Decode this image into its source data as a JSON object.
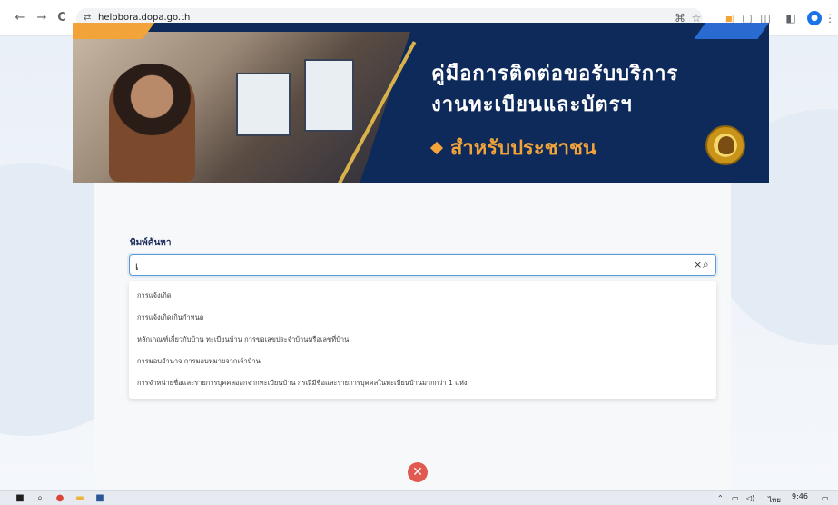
{
  "browser": {
    "back": "←",
    "forward": "→",
    "reload": "C",
    "site_icon": "⇄",
    "url": "helpbora.dopa.go.th",
    "tools": [
      "translate-icon",
      "star-icon",
      "extension-icon",
      "screenshot-icon",
      "puzzle-icon",
      "sidepanel-icon"
    ],
    "profile_initial": "●",
    "menu": "⋮"
  },
  "banner": {
    "line1": "คู่มือการติดต่อขอรับบริการ",
    "line2": "งานทะเบียนและบัตรฯ",
    "line3": "สำหรับประชาชน"
  },
  "search": {
    "label": "พิมพ์ค้นหา",
    "value": "เ",
    "clear": "×",
    "icon": "🔍"
  },
  "suggestions": [
    "การแจ้งเกิด",
    "การแจ้งเกิดเกินกำหนด",
    "หลักเกณฑ์เกี่ยวกับบ้าน ทะเบียนบ้าน การขอเลขประจำบ้านหรือเลขที่บ้าน",
    "การมอบอำนาจ การมอบหมายจากเจ้าบ้าน",
    "การจำหน่ายชื่อและรายการบุคคลออกจากทะเบียนบ้าน กรณีมีชื่อและรายการบุคคลในทะเบียนบ้านมากกว่า 1 แห่ง"
  ],
  "error_icon": "✕",
  "taskbar": {
    "clock_time": "9:46",
    "lang": "ไทย"
  }
}
